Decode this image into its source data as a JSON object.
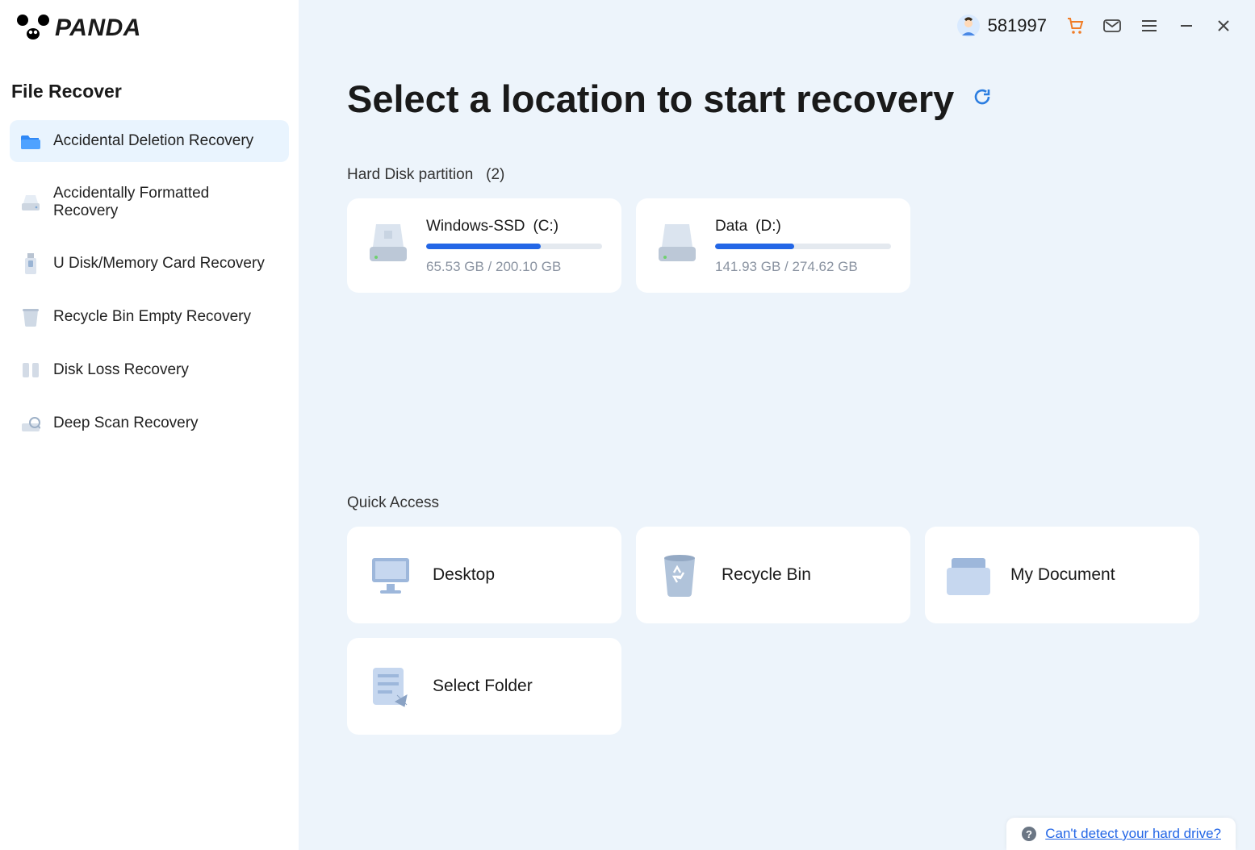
{
  "logo_text": "PANDA",
  "sidebar": {
    "title": "File Recover",
    "items": [
      {
        "label": "Accidental Deletion Recovery",
        "icon": "folder-icon",
        "active": true
      },
      {
        "label": "Accidentally Formatted Recovery",
        "icon": "drive-icon",
        "active": false
      },
      {
        "label": "U Disk/Memory Card Recovery",
        "icon": "usb-icon",
        "active": false
      },
      {
        "label": "Recycle Bin Empty Recovery",
        "icon": "bin-icon",
        "active": false
      },
      {
        "label": "Disk Loss Recovery",
        "icon": "diskloss-icon",
        "active": false
      },
      {
        "label": "Deep Scan Recovery",
        "icon": "deepscan-icon",
        "active": false
      }
    ]
  },
  "titlebar": {
    "user_id": "581997"
  },
  "page_title": "Select a location to start recovery",
  "partitions": {
    "label": "Hard Disk partition",
    "count_text": "(2)",
    "items": [
      {
        "name": "Windows-SSD",
        "letter": "(C:)",
        "used": "65.53 GB",
        "total": "200.10 GB",
        "size_text": "65.53 GB / 200.10 GB",
        "fill_pct": 65
      },
      {
        "name": "Data",
        "letter": "(D:)",
        "used": "141.93 GB",
        "total": "274.62 GB",
        "size_text": "141.93 GB / 274.62 GB",
        "fill_pct": 45
      }
    ]
  },
  "quick": {
    "label": "Quick Access",
    "items": [
      {
        "label": "Desktop",
        "icon": "desktop-icon"
      },
      {
        "label": "Recycle Bin",
        "icon": "recyclebin-icon"
      },
      {
        "label": "My Document",
        "icon": "document-icon"
      },
      {
        "label": "Select Folder",
        "icon": "selectfolder-icon"
      }
    ]
  },
  "help_text": "Can't detect your hard drive?"
}
